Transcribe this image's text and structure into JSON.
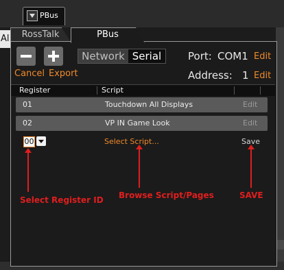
{
  "top_tab": {
    "label": "PBus"
  },
  "left_fragment": "Al",
  "tabs": [
    {
      "label": "RossTalk",
      "active": false
    },
    {
      "label": "PBus",
      "active": true
    }
  ],
  "toolbar": {
    "cancel": "Cancel",
    "export": "Export",
    "mode_options": [
      "Network",
      "Serial"
    ],
    "selected_mode": "Serial",
    "port_label": "Port:",
    "port_value": "COM1",
    "port_edit": "Edit",
    "address_label": "Address:",
    "address_value": "1",
    "address_edit": "Edit"
  },
  "table": {
    "headers": [
      "Register",
      "Script"
    ],
    "rows": [
      {
        "register": "01",
        "script": "Touchdown All Displays",
        "action": "Edit"
      },
      {
        "register": "02",
        "script": "VP IN Game Look",
        "action": "Edit"
      }
    ]
  },
  "new_row": {
    "register_value": "00",
    "script_placeholder": "Select Script...",
    "save": "Save"
  },
  "annotations": {
    "register": "Select Register ID",
    "script": "Browse Script/Pages",
    "save": "SAVE"
  },
  "colors": {
    "accent": "#f08a2a",
    "annotation": "#e01e1e"
  }
}
